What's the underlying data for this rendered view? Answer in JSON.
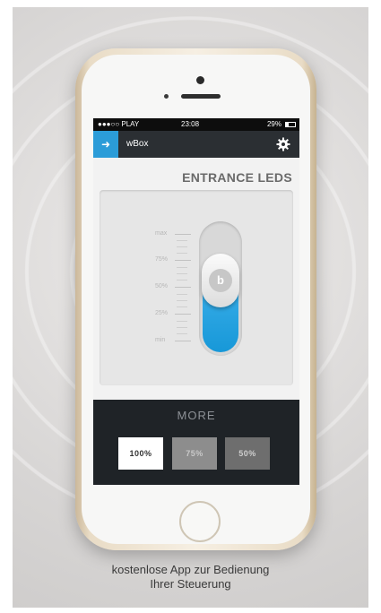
{
  "status_bar": {
    "carrier": "●●●○○ PLAY",
    "time": "23:08",
    "battery": "29%"
  },
  "app_bar": {
    "back_icon": "back-arrow-icon",
    "title": "wBox",
    "settings_icon": "gear-icon"
  },
  "device": {
    "title": "ENTRANCE LEDS",
    "brightness_level": 0.72
  },
  "scale": {
    "labels": [
      "max",
      "75%",
      "50%",
      "25%",
      "min"
    ]
  },
  "more": {
    "label": "MORE",
    "presets": [
      "100%",
      "75%",
      "50%"
    ]
  },
  "caption": {
    "line1": "kostenlose App zur Bedienung",
    "line2": "Ihrer Steuerung"
  },
  "colors": {
    "accent": "#2b9cd8",
    "slider_fill": "#1798d8",
    "app_bar": "#2b2f33"
  }
}
